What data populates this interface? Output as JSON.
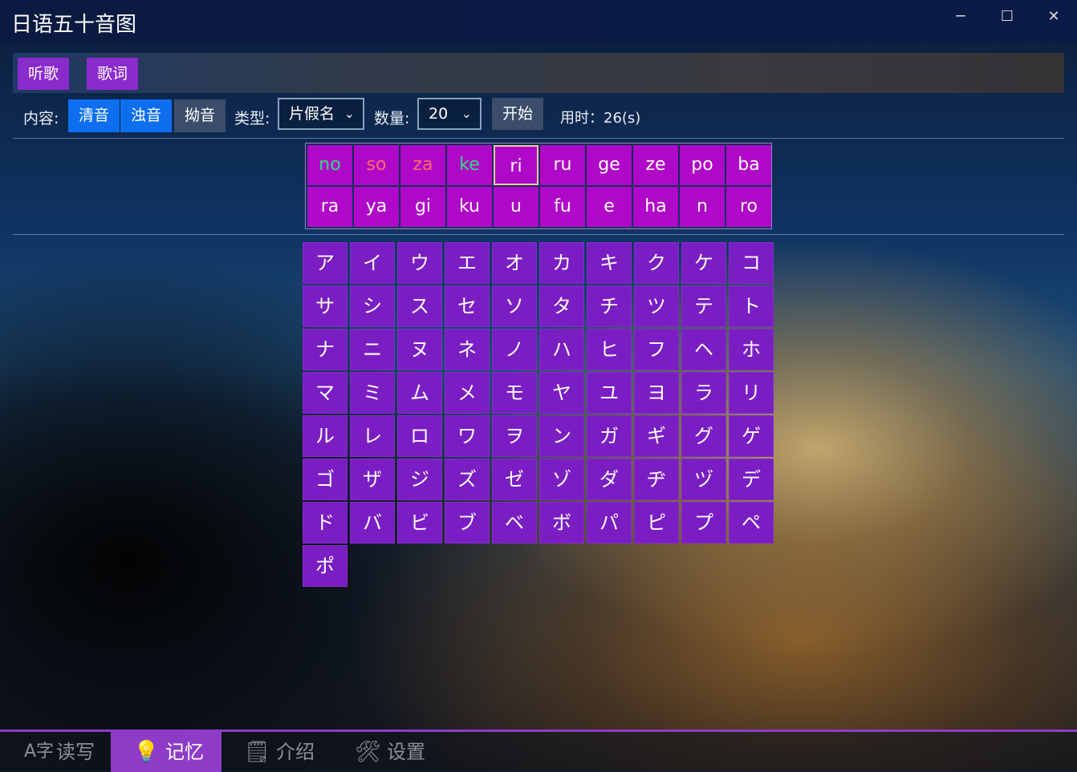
{
  "window": {
    "title": "日语五十音图",
    "controls": {
      "minimize": "─",
      "maximize": "☐",
      "close": "✕"
    }
  },
  "music": {
    "listen_label": "听歌",
    "lyrics_label": "歌词"
  },
  "toolbar": {
    "content_label": "内容:",
    "content_buttons": [
      {
        "label": "清音",
        "active": true
      },
      {
        "label": "浊音",
        "active": true
      },
      {
        "label": "拗音",
        "active": false
      }
    ],
    "type_label": "类型:",
    "type_value": "片假名",
    "count_label": "数量:",
    "count_value": "20",
    "start_label": "开始",
    "timer_text": "用时：26(s)"
  },
  "quiz": {
    "items": [
      {
        "text": "no",
        "state": "correct"
      },
      {
        "text": "so",
        "state": "wrong"
      },
      {
        "text": "za",
        "state": "wrong"
      },
      {
        "text": "ke",
        "state": "correct"
      },
      {
        "text": "ri",
        "state": "current"
      },
      {
        "text": "ru",
        "state": "pending"
      },
      {
        "text": "ge",
        "state": "pending"
      },
      {
        "text": "ze",
        "state": "pending"
      },
      {
        "text": "po",
        "state": "pending"
      },
      {
        "text": "ba",
        "state": "pending"
      },
      {
        "text": "ra",
        "state": "pending"
      },
      {
        "text": "ya",
        "state": "pending"
      },
      {
        "text": "gi",
        "state": "pending"
      },
      {
        "text": "ku",
        "state": "pending"
      },
      {
        "text": "u",
        "state": "pending"
      },
      {
        "text": "fu",
        "state": "pending"
      },
      {
        "text": "e",
        "state": "pending"
      },
      {
        "text": "ha",
        "state": "pending"
      },
      {
        "text": "n",
        "state": "pending"
      },
      {
        "text": "ro",
        "state": "pending"
      }
    ]
  },
  "kana": [
    "ア",
    "イ",
    "ウ",
    "エ",
    "オ",
    "カ",
    "キ",
    "ク",
    "ケ",
    "コ",
    "サ",
    "シ",
    "ス",
    "セ",
    "ソ",
    "タ",
    "チ",
    "ツ",
    "テ",
    "ト",
    "ナ",
    "ニ",
    "ヌ",
    "ネ",
    "ノ",
    "ハ",
    "ヒ",
    "フ",
    "ヘ",
    "ホ",
    "マ",
    "ミ",
    "ム",
    "メ",
    "モ",
    "ヤ",
    "ユ",
    "ヨ",
    "ラ",
    "リ",
    "ル",
    "レ",
    "ロ",
    "ワ",
    "ヲ",
    "ン",
    "ガ",
    "ギ",
    "グ",
    "ゲ",
    "ゴ",
    "ザ",
    "ジ",
    "ズ",
    "ゼ",
    "ゾ",
    "ダ",
    "ヂ",
    "ヅ",
    "デ",
    "ド",
    "バ",
    "ビ",
    "ブ",
    "ベ",
    "ボ",
    "パ",
    "ピ",
    "プ",
    "ペ",
    "ポ"
  ],
  "nav": [
    {
      "label": "读写",
      "icon": "text-icon",
      "glyph": "A字",
      "active": false
    },
    {
      "label": "记忆",
      "icon": "lightbulb-icon",
      "glyph": "💡",
      "active": true
    },
    {
      "label": "介绍",
      "icon": "document-icon",
      "glyph": "🗒",
      "active": false
    },
    {
      "label": "设置",
      "icon": "tools-icon",
      "glyph": "🛠",
      "active": false
    }
  ],
  "colors": {
    "accent_purple": "#8e3cc8",
    "active_blue": "#0d6fef",
    "kana_cell": "#7a1ec4",
    "quiz_cell": "#b008c8",
    "correct_text": "#2ee07a",
    "wrong_text": "#ff6b6b"
  }
}
